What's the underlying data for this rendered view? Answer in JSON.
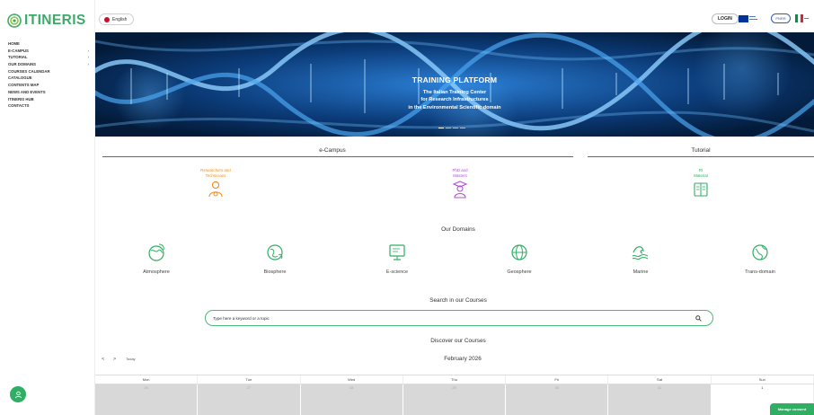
{
  "brand": {
    "name": "ITINERIS"
  },
  "sidebar": {
    "items": [
      {
        "label": "HOME",
        "has_children": false
      },
      {
        "label": "E-CAMPUS",
        "has_children": true
      },
      {
        "label": "TUTORIAL",
        "has_children": true
      },
      {
        "label": "OUR DOMAINS",
        "has_children": true
      },
      {
        "label": "COURSES CALENDAR",
        "has_children": false
      },
      {
        "label": "CATALOGUE",
        "has_children": false
      },
      {
        "label": "CONTENTS MAP",
        "has_children": false
      },
      {
        "label": "NEWS AND EVENTS",
        "has_children": false
      },
      {
        "label": "ITINERIS HUB",
        "has_children": false
      },
      {
        "label": "CONTACTS",
        "has_children": false
      }
    ]
  },
  "topbar": {
    "language": "English",
    "login": "LOGIN",
    "pnrr_label": "PNRR"
  },
  "hero": {
    "title": "TRAINING PLATFORM",
    "subtitle_lines": [
      "The Italian Training Center",
      "for Research Infrastructures",
      "in the Environmental Scientific domain"
    ],
    "slides": 4,
    "active_slide": 0
  },
  "ecampus": {
    "title": "e-Campus",
    "profiles": [
      {
        "line1": "Researchers and",
        "line2": "Technicians",
        "color": "#f08a1c",
        "icon": "researcher-icon"
      },
      {
        "line1": "PhD and",
        "line2": "Masters",
        "color": "#b04fd8",
        "icon": "graduate-icon"
      }
    ]
  },
  "tutorial": {
    "title": "Tutorial",
    "profiles": [
      {
        "line1": "RI",
        "line2": "Material",
        "color": "#2fae64",
        "icon": "book-icon"
      }
    ]
  },
  "domains": {
    "title": "Our Domains",
    "items": [
      {
        "label": "Atmosphere",
        "icon": "atmosphere-icon"
      },
      {
        "label": "Biosphere",
        "icon": "biosphere-icon"
      },
      {
        "label": "E-science",
        "icon": "e-science-icon"
      },
      {
        "label": "Geosphere",
        "icon": "geosphere-icon"
      },
      {
        "label": "Marine",
        "icon": "marine-icon"
      },
      {
        "label": "Trans-domain",
        "icon": "trans-domain-icon"
      }
    ]
  },
  "search": {
    "title": "Search in our Courses",
    "placeholder": "Type here a keyword or a topic"
  },
  "discover": {
    "title": "Discover our Courses"
  },
  "calendar": {
    "prev": "<",
    "next": ">",
    "today": "Today",
    "month": "February 2026",
    "weekdays": [
      "Mon",
      "Tue",
      "Wed",
      "Thu",
      "Fri",
      "Sat",
      "Sun"
    ],
    "first_row": [
      {
        "day": "26",
        "current_month": false
      },
      {
        "day": "27",
        "current_month": false
      },
      {
        "day": "28",
        "current_month": false
      },
      {
        "day": "29",
        "current_month": false
      },
      {
        "day": "30",
        "current_month": false
      },
      {
        "day": "31",
        "current_month": false
      },
      {
        "day": "1",
        "current_month": true
      }
    ]
  },
  "consent": {
    "label": "Manage consent"
  },
  "colors": {
    "accent": "#2fae64",
    "researcher": "#f08a1c",
    "phd": "#b04fd8"
  }
}
